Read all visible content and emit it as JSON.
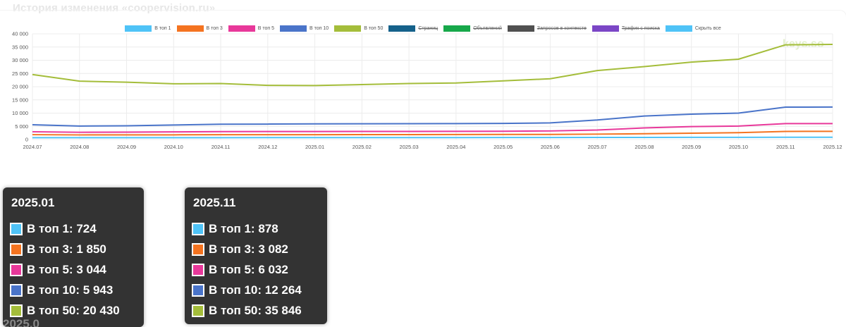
{
  "header": {
    "title": "История изменения «coopervision.ru»"
  },
  "watermark": "keys.so",
  "chart_data": {
    "type": "line",
    "x": [
      "2024.07",
      "2024.08",
      "2024.09",
      "2024.10",
      "2024.11",
      "2024.12",
      "2025.01",
      "2025.02",
      "2025.03",
      "2025.04",
      "2025.05",
      "2025.06",
      "2025.07",
      "2025.08",
      "2025.09",
      "2025.10",
      "2025.11",
      "2025.12"
    ],
    "ylim": [
      0,
      40000
    ],
    "yticks": [
      0,
      5000,
      10000,
      15000,
      20000,
      25000,
      30000,
      35000,
      40000
    ],
    "ytick_labels": [
      "0",
      "5 000",
      "10 000",
      "15 000",
      "20 000",
      "25 000",
      "30 000",
      "35 000",
      "40 000"
    ],
    "grid": true,
    "legend_position": "top-center",
    "series": [
      {
        "name": "В топ 1",
        "color": "#4fc3f7",
        "values": [
          700,
          700,
          705,
          710,
          715,
          720,
          724,
          730,
          740,
          750,
          760,
          770,
          790,
          810,
          830,
          850,
          878,
          880
        ]
      },
      {
        "name": "В топ 3",
        "color": "#f47320",
        "values": [
          1850,
          1750,
          1760,
          1780,
          1820,
          1840,
          1850,
          1860,
          1880,
          1900,
          1920,
          1950,
          2050,
          2200,
          2400,
          2600,
          3082,
          3100
        ]
      },
      {
        "name": "В топ 5",
        "color": "#e8389a",
        "values": [
          2950,
          2750,
          2800,
          2900,
          3000,
          3020,
          3044,
          3060,
          3080,
          3100,
          3150,
          3250,
          3600,
          4400,
          4900,
          5100,
          6032,
          6050
        ]
      },
      {
        "name": "В топ 10",
        "color": "#4a74c9",
        "values": [
          5600,
          5100,
          5200,
          5500,
          5800,
          5850,
          5943,
          5960,
          6000,
          6050,
          6100,
          6300,
          7400,
          8900,
          9600,
          10000,
          12264,
          12300
        ]
      },
      {
        "name": "В топ 50",
        "color": "#a4bd3a",
        "values": [
          24600,
          22100,
          21700,
          21100,
          21200,
          20500,
          20430,
          20800,
          21200,
          21400,
          22200,
          23000,
          26100,
          27600,
          29300,
          30400,
          35846,
          36000
        ]
      }
    ],
    "hidden_series": [
      {
        "name": "Страниц",
        "color": "#15618a"
      },
      {
        "name": "Объявлений",
        "color": "#17a84a"
      },
      {
        "name": "Запросов в контексте",
        "color": "#505050"
      },
      {
        "name": "Трафик с поиска",
        "color": "#7b46c6"
      }
    ],
    "hide_all": {
      "name": "Скрыть все",
      "color": "#4fc3f7"
    }
  },
  "tooltips": [
    {
      "title": "2025.01",
      "rows": [
        {
          "label": "В топ 1: 724",
          "color": "#4fc3f7"
        },
        {
          "label": "В топ 3: 1 850",
          "color": "#f47320"
        },
        {
          "label": "В топ 5: 3 044",
          "color": "#e8389a"
        },
        {
          "label": "В топ 10: 5 943",
          "color": "#4a74c9"
        },
        {
          "label": "В топ 50: 20 430",
          "color": "#a4bd3a"
        }
      ],
      "peek": "2025.0"
    },
    {
      "title": "2025.11",
      "rows": [
        {
          "label": "В топ 1: 878",
          "color": "#4fc3f7"
        },
        {
          "label": "В топ 3: 3 082",
          "color": "#f47320"
        },
        {
          "label": "В топ 5: 6 032",
          "color": "#e8389a"
        },
        {
          "label": "В топ 10: 12 264",
          "color": "#4a74c9"
        },
        {
          "label": "В топ 50: 35 846",
          "color": "#a4bd3a"
        }
      ]
    }
  ]
}
